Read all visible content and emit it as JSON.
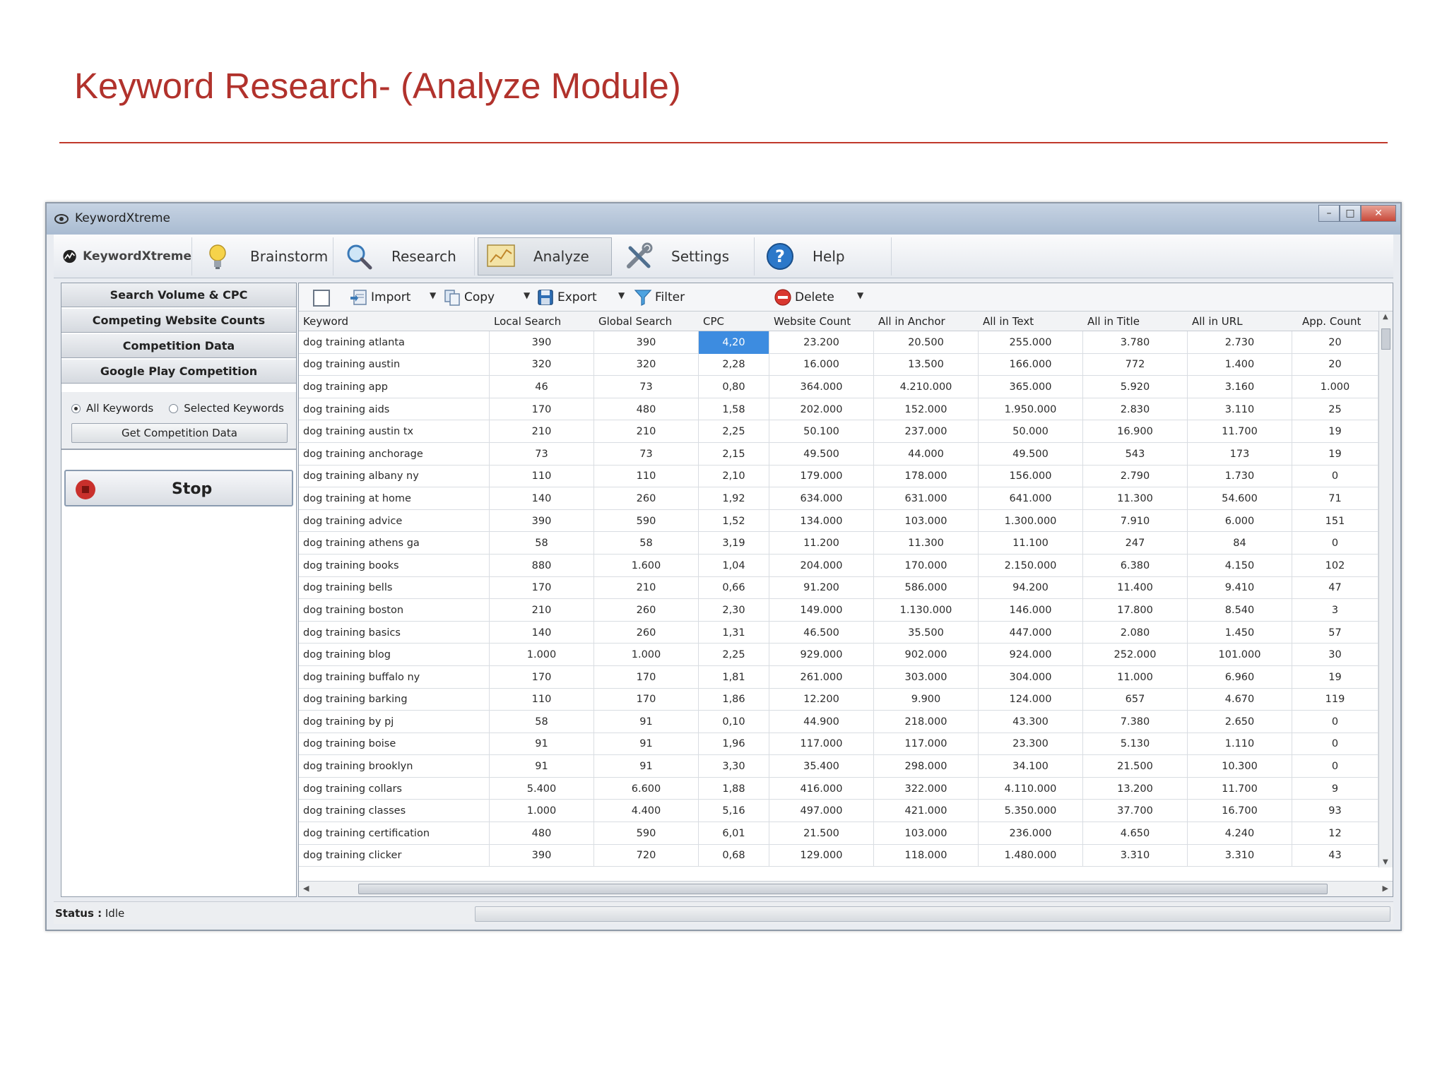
{
  "slide": {
    "title": "Keyword Research- (Analyze Module)"
  },
  "window": {
    "title": "KeywordXtreme"
  },
  "ribbon": {
    "tabs": [
      {
        "label": "KeywordXtreme",
        "icon": "app-logo-icon"
      },
      {
        "label": "Brainstorm",
        "icon": "lightbulb-icon"
      },
      {
        "label": "Research",
        "icon": "magnifier-icon"
      },
      {
        "label": "Analyze",
        "icon": "chart-icon",
        "active": true
      },
      {
        "label": "Settings",
        "icon": "tools-icon"
      },
      {
        "label": "Help",
        "icon": "help-icon"
      }
    ]
  },
  "sidebar": {
    "buttons": [
      "Search Volume & CPC",
      "Competing Website Counts",
      "Competition Data",
      "Google Play Competition"
    ],
    "radio_all": "All Keywords",
    "radio_selected": "Selected Keywords",
    "get_button": "Get Competition Data",
    "stop_label": "Stop"
  },
  "toolbar": {
    "import": "Import",
    "copy": "Copy",
    "export": "Export",
    "filter": "Filter",
    "delete": "Delete"
  },
  "table": {
    "columns": [
      "Keyword",
      "Local Search",
      "Global Search",
      "CPC",
      "Website Count",
      "All in Anchor",
      "All in Text",
      "All in Title",
      "All in URL",
      "App. Count"
    ],
    "rows": [
      [
        "dog training atlanta",
        "390",
        "390",
        "4,20",
        "23.200",
        "20.500",
        "255.000",
        "3.780",
        "2.730",
        "20"
      ],
      [
        "dog training austin",
        "320",
        "320",
        "2,28",
        "16.000",
        "13.500",
        "166.000",
        "772",
        "1.400",
        "20"
      ],
      [
        "dog training app",
        "46",
        "73",
        "0,80",
        "364.000",
        "4.210.000",
        "365.000",
        "5.920",
        "3.160",
        "1.000"
      ],
      [
        "dog training aids",
        "170",
        "480",
        "1,58",
        "202.000",
        "152.000",
        "1.950.000",
        "2.830",
        "3.110",
        "25"
      ],
      [
        "dog training austin tx",
        "210",
        "210",
        "2,25",
        "50.100",
        "237.000",
        "50.000",
        "16.900",
        "11.700",
        "19"
      ],
      [
        "dog training anchorage",
        "73",
        "73",
        "2,15",
        "49.500",
        "44.000",
        "49.500",
        "543",
        "173",
        "19"
      ],
      [
        "dog training albany ny",
        "110",
        "110",
        "2,10",
        "179.000",
        "178.000",
        "156.000",
        "2.790",
        "1.730",
        "0"
      ],
      [
        "dog training at home",
        "140",
        "260",
        "1,92",
        "634.000",
        "631.000",
        "641.000",
        "11.300",
        "54.600",
        "71"
      ],
      [
        "dog training advice",
        "390",
        "590",
        "1,52",
        "134.000",
        "103.000",
        "1.300.000",
        "7.910",
        "6.000",
        "151"
      ],
      [
        "dog training athens ga",
        "58",
        "58",
        "3,19",
        "11.200",
        "11.300",
        "11.100",
        "247",
        "84",
        "0"
      ],
      [
        "dog training books",
        "880",
        "1.600",
        "1,04",
        "204.000",
        "170.000",
        "2.150.000",
        "6.380",
        "4.150",
        "102"
      ],
      [
        "dog training bells",
        "170",
        "210",
        "0,66",
        "91.200",
        "586.000",
        "94.200",
        "11.400",
        "9.410",
        "47"
      ],
      [
        "dog training boston",
        "210",
        "260",
        "2,30",
        "149.000",
        "1.130.000",
        "146.000",
        "17.800",
        "8.540",
        "3"
      ],
      [
        "dog training basics",
        "140",
        "260",
        "1,31",
        "46.500",
        "35.500",
        "447.000",
        "2.080",
        "1.450",
        "57"
      ],
      [
        "dog training blog",
        "1.000",
        "1.000",
        "2,25",
        "929.000",
        "902.000",
        "924.000",
        "252.000",
        "101.000",
        "30"
      ],
      [
        "dog training buffalo ny",
        "170",
        "170",
        "1,81",
        "261.000",
        "303.000",
        "304.000",
        "11.000",
        "6.960",
        "19"
      ],
      [
        "dog training barking",
        "110",
        "170",
        "1,86",
        "12.200",
        "9.900",
        "124.000",
        "657",
        "4.670",
        "119"
      ],
      [
        "dog training by pj",
        "58",
        "91",
        "0,10",
        "44.900",
        "218.000",
        "43.300",
        "7.380",
        "2.650",
        "0"
      ],
      [
        "dog training boise",
        "91",
        "91",
        "1,96",
        "117.000",
        "117.000",
        "23.300",
        "5.130",
        "1.110",
        "0"
      ],
      [
        "dog training brooklyn",
        "91",
        "91",
        "3,30",
        "35.400",
        "298.000",
        "34.100",
        "21.500",
        "10.300",
        "0"
      ],
      [
        "dog training collars",
        "5.400",
        "6.600",
        "1,88",
        "416.000",
        "322.000",
        "4.110.000",
        "13.200",
        "11.700",
        "9"
      ],
      [
        "dog training classes",
        "1.000",
        "4.400",
        "5,16",
        "497.000",
        "421.000",
        "5.350.000",
        "37.700",
        "16.700",
        "93"
      ],
      [
        "dog training certification",
        "480",
        "590",
        "6,01",
        "21.500",
        "103.000",
        "236.000",
        "4.650",
        "4.240",
        "12"
      ],
      [
        "dog training clicker",
        "390",
        "720",
        "0,68",
        "129.000",
        "118.000",
        "1.480.000",
        "3.310",
        "3.310",
        "43"
      ]
    ],
    "selected_cell": {
      "row": 0,
      "col": 3
    }
  },
  "status": {
    "label": "Status :",
    "value": "Idle",
    "progress": 0
  },
  "colors": {
    "title_red": "#b1322c",
    "selection_blue": "#3d8ce0",
    "stop_red": "#c9302c"
  }
}
